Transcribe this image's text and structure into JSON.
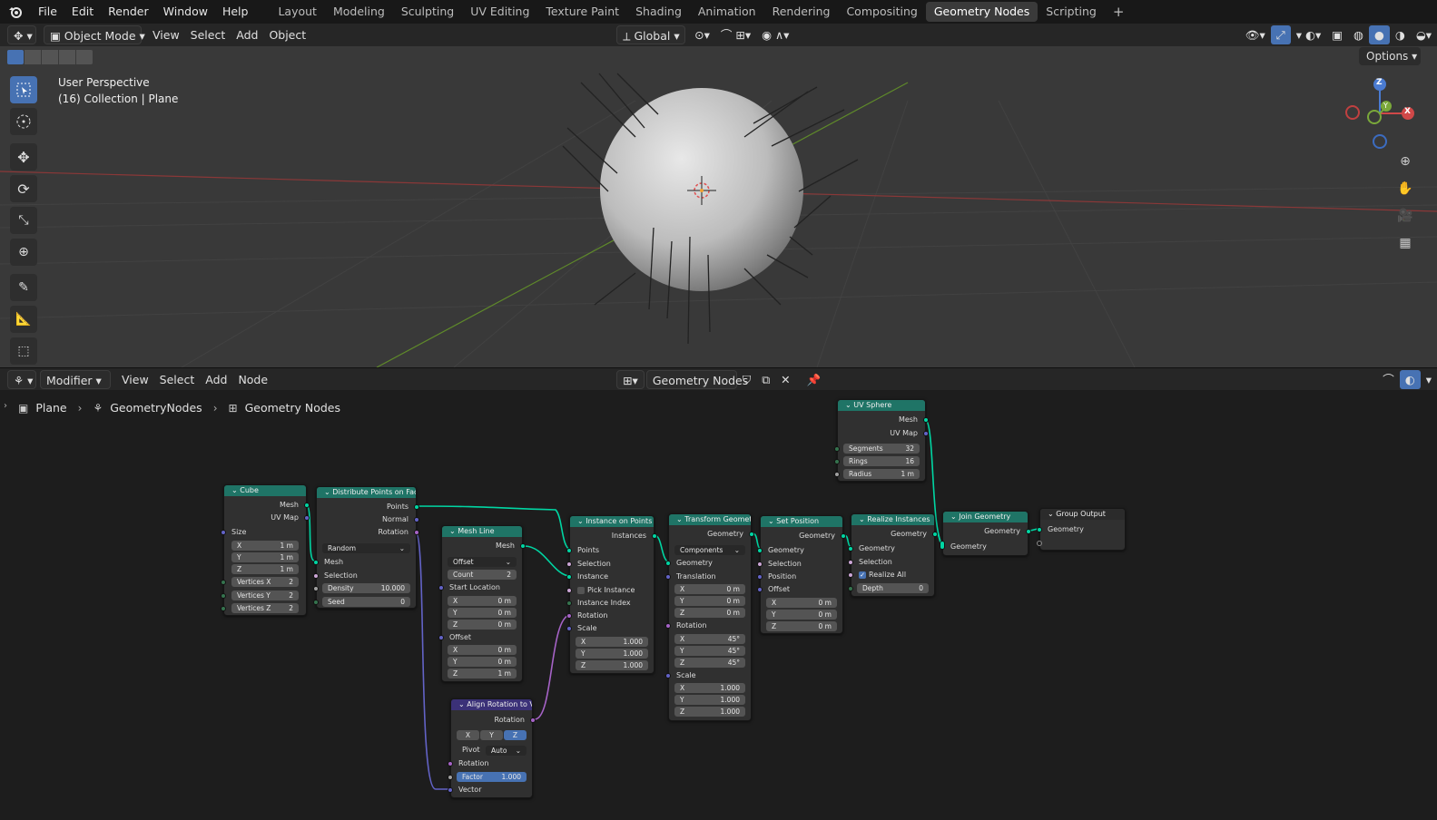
{
  "menu": {
    "file": "File",
    "edit": "Edit",
    "render": "Render",
    "window": "Window",
    "help": "Help"
  },
  "workspaces": [
    "Layout",
    "Modeling",
    "Sculpting",
    "UV Editing",
    "Texture Paint",
    "Shading",
    "Animation",
    "Rendering",
    "Compositing",
    "Geometry Nodes",
    "Scripting"
  ],
  "workspace_add": "+",
  "viewport_header": {
    "mode": "Object Mode",
    "view": "View",
    "select": "Select",
    "add": "Add",
    "object": "Object",
    "orientation": "Global",
    "options": "Options"
  },
  "viewport": {
    "perspective": "User Perspective",
    "collection": "(16) Collection | Plane",
    "gizmo": {
      "z": "Z",
      "y": "Y",
      "x": "X"
    }
  },
  "node_header": {
    "editor": "Modifier",
    "view": "View",
    "select": "Select",
    "add": "Add",
    "node": "Node",
    "tree_name": "Geometry Nodes"
  },
  "breadcrumb": [
    "Plane",
    "GeometryNodes",
    "Geometry Nodes"
  ],
  "nodes": {
    "cube": {
      "title": "Cube",
      "out_mesh": "Mesh",
      "out_uvmap": "UV Map",
      "size": "Size",
      "x": "X",
      "xv": "1 m",
      "y": "Y",
      "yv": "1 m",
      "z": "Z",
      "zv": "1 m",
      "vx": "Vertices X",
      "vxv": "2",
      "vy": "Vertices Y",
      "vyv": "2",
      "vz": "Vertices Z",
      "vzv": "2"
    },
    "distribute": {
      "title": "Distribute Points on Faces",
      "points": "Points",
      "normal": "Normal",
      "rotation": "Rotation",
      "mode": "Random",
      "mesh": "Mesh",
      "selection": "Selection",
      "density": "Density",
      "density_v": "10.000",
      "seed": "Seed",
      "seed_v": "0"
    },
    "meshline": {
      "title": "Mesh Line",
      "mesh": "Mesh",
      "mode": "Offset",
      "count": "Count",
      "count_v": "2",
      "start": "Start Location",
      "x": "X",
      "xv": "0 m",
      "y": "Y",
      "yv": "0 m",
      "z": "Z",
      "zv": "0 m",
      "offset": "Offset",
      "ox": "X",
      "oxv": "0 m",
      "oy": "Y",
      "oyv": "0 m",
      "oz": "Z",
      "ozv": "1 m"
    },
    "align": {
      "title": "Align Rotation to V...",
      "rotation_out": "Rotation",
      "ax": "X",
      "ay": "Y",
      "az": "Z",
      "pivot": "Pivot",
      "pivot_v": "Auto",
      "rotation": "Rotation",
      "factor": "Factor",
      "factor_v": "1.000",
      "vector": "Vector"
    },
    "instance": {
      "title": "Instance on Points",
      "instances": "Instances",
      "points": "Points",
      "selection": "Selection",
      "instance": "Instance",
      "pick": "Pick Instance",
      "index": "Instance Index",
      "rotation": "Rotation",
      "scale": "Scale",
      "x": "X",
      "xv": "1.000",
      "y": "Y",
      "yv": "1.000",
      "z": "Z",
      "zv": "1.000"
    },
    "transform": {
      "title": "Transform Geometry",
      "geometry_out": "Geometry",
      "mode": "Components",
      "geometry": "Geometry",
      "translation": "Translation",
      "tx": "X",
      "txv": "0 m",
      "ty": "Y",
      "tyv": "0 m",
      "tz": "Z",
      "tzv": "0 m",
      "rotation": "Rotation",
      "rx": "X",
      "rxv": "45°",
      "ry": "Y",
      "ryv": "45°",
      "rz": "Z",
      "rzv": "45°",
      "scale": "Scale",
      "sx": "X",
      "sxv": "1.000",
      "sy": "Y",
      "syv": "1.000",
      "sz": "Z",
      "szv": "1.000"
    },
    "setpos": {
      "title": "Set Position",
      "geometry_out": "Geometry",
      "geometry": "Geometry",
      "selection": "Selection",
      "position": "Position",
      "offset": "Offset",
      "x": "X",
      "xv": "0 m",
      "y": "Y",
      "yv": "0 m",
      "z": "Z",
      "zv": "0 m"
    },
    "realize": {
      "title": "Realize Instances",
      "geometry_out": "Geometry",
      "geometry": "Geometry",
      "selection": "Selection",
      "realize_all": "Realize All",
      "depth": "Depth",
      "depth_v": "0"
    },
    "uvsphere": {
      "title": "UV Sphere",
      "mesh": "Mesh",
      "uvmap": "UV Map",
      "segments": "Segments",
      "segments_v": "32",
      "rings": "Rings",
      "rings_v": "16",
      "radius": "Radius",
      "radius_v": "1 m"
    },
    "join": {
      "title": "Join Geometry",
      "geometry_out": "Geometry",
      "geometry": "Geometry"
    },
    "output": {
      "title": "Group Output",
      "geometry": "Geometry"
    }
  },
  "colors": {
    "geometry_socket": "#00d6a3",
    "vector_socket": "#6363c7",
    "rotation_socket": "#a663c7",
    "header_geometry": "#1f7466",
    "accent": "#4772b3"
  }
}
